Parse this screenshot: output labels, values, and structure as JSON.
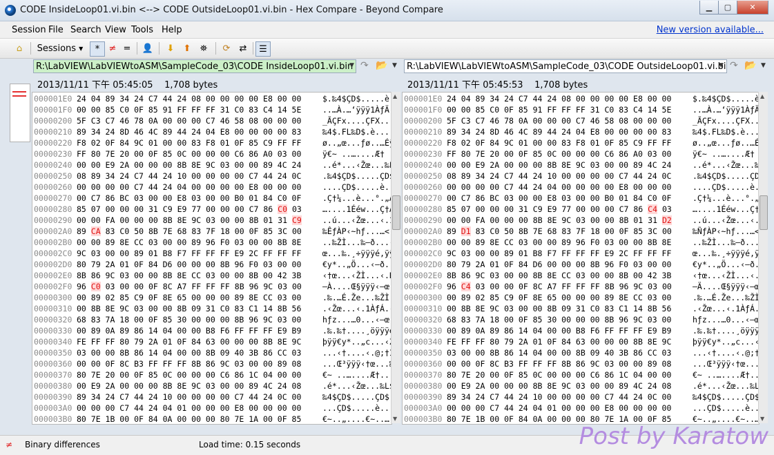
{
  "window": {
    "title": "CODE InsideLoop01.vi.bin <--> CODE OutsideLoop01.vi.bin - Hex Compare - Beyond Compare"
  },
  "menu": {
    "items": [
      "Session",
      "File",
      "Search",
      "View",
      "Tools",
      "Help"
    ],
    "new_version": "New version available..."
  },
  "toolbar": {
    "sessions_label": "Sessions"
  },
  "left": {
    "path": "R:\\LabVIEW\\LabVIEWtoASM\\SampleCode_03\\CODE InsideLoop01.vi.bin",
    "timestamp": "2013/11/11 下午 05:45:05",
    "size": "1,708 bytes"
  },
  "right": {
    "path": "R:\\LabVIEW\\LabVIEWtoASM\\SampleCode_03\\CODE OutsideLoop01.vi.bin",
    "timestamp": "2013/11/11 下午 05:45:53",
    "size": "1,708 bytes"
  },
  "rows": [
    {
      "off": "000001E0",
      "hex": "24 04 89 34 24 C7 44 24 08 00 00 00 00 E8 00 00",
      "asc": "$.‰4$ÇD$.....è.."
    },
    {
      "off": "000001F0",
      "hex": "00 00 85 C0 0F 85 91 FF FF FF 31 C0 83 C4 14 5E",
      "asc": "..…À.…‘ÿÿÿ1ÀƒÄ.^"
    },
    {
      "off": "00000200",
      "hex": "5F C3 C7 46 78 0A 00 00 00 C7 46 58 08 00 00 00",
      "asc": "_ÃÇFx....ÇFX...."
    },
    {
      "off": "00000210",
      "hex": "89 34 24 8D 46 4C 89 44 24 04 E8 00 00 00 00 83",
      "asc": "‰4$.FL‰D$.è....ƒ"
    },
    {
      "off": "00000220",
      "hex": "F8 02 0F 84 9C 01 00 00 83 F8 01 0F 85 C9 FF FF",
      "asc": "ø..„œ...ƒø..…Éÿÿ"
    },
    {
      "off": "00000230",
      "hex": "FF 80 7E 20 00 0F 85 0C 00 00 00 C6 86 A0 03 00",
      "asc": "ÿ€~ ..…....Æ† .."
    },
    {
      "off": "00000240",
      "hex": "00 00 E9 2A 00 00 00 8B 8E 9C 03 00 00 89 4C 24",
      "asc": "..é*...‹Žœ...‰L$"
    },
    {
      "off": "00000250",
      "hex": "08 89 34 24 C7 44 24 10 00 00 00 00 C7 44 24 0C",
      "asc": ".‰4$ÇD$.....ÇD$."
    },
    {
      "off": "00000260",
      "hex": "00 00 00 00 C7 44 24 04 00 00 00 00 E8 00 00 00",
      "asc": "....ÇD$.....è..."
    },
    {
      "off": "00000270",
      "hex": "00 C7 86 BC 03 00 00 E8 03 00 00 B0 01 84 C0 0F",
      "asc": ".Ç†¼...è...°.„À."
    },
    {
      "off": "00000280",
      "hex": "85 07 00 00 00 31 C9 E9 77 00 00 00 C7 86 C0 03",
      "asc": "…....1Ééw...Ç†À."
    },
    {
      "off": "00000290",
      "hex": "00 00 FA 00 00 00 8B 8E 9C 03 00 00 8B 01 31 C9",
      "asc": "..ú...‹Žœ...‹.1É"
    },
    {
      "off": "000002A0",
      "hex": "89 CA 83 C0 50 8B 7E 68 83 7F 18 00 0F 85 3C 00",
      "asc": "‰ÊƒÀP‹~hƒ...…<."
    },
    {
      "off": "000002B0",
      "hex": "00 00 89 8E CC 03 00 00 89 96 F0 03 00 00 8B 8E",
      "asc": "..‰ŽÌ...‰–ð...‹Ž"
    },
    {
      "off": "000002C0",
      "hex": "9C 03 00 00 89 01 B8 F7 FF FF FF E9 2C FF FF FF",
      "asc": "œ...‰.¸÷ÿÿÿé,ÿÿÿ"
    },
    {
      "off": "000002D0",
      "hex": "80 79 2A 01 0F 84 D6 00 00 00 8B 96 F0 03 00 00",
      "asc": "€y*..„Ö...‹–ð..."
    },
    {
      "off": "000002E0",
      "hex": "8B 86 9C 03 00 00 8B 8E CC 03 00 00 8B 00 42 3B",
      "asc": "‹†œ...‹ŽÌ...‹.B;"
    },
    {
      "off": "000002F0",
      "hex": "96 C0 03 00 00 0F 8C A7 FF FF FF 8B 96 9C 03 00",
      "asc": "–À....Œ§ÿÿÿ‹–œ.."
    },
    {
      "off": "00000300",
      "hex": "00 89 02 85 C9 0F 8E 65 00 00 00 89 8E CC 03 00",
      "asc": ".‰.…É.Že...‰ŽÌ.."
    },
    {
      "off": "00000310",
      "hex": "00 8B 8E 9C 03 00 00 8B 09 31 C0 83 C1 14 8B 56",
      "asc": ".‹Žœ...‹.1ÀƒÁ.‹V"
    },
    {
      "off": "00000320",
      "hex": "68 83 7A 18 00 0F 85 30 00 00 00 8B 96 9C 03 00",
      "asc": "hƒz...…0...‹–œ.."
    },
    {
      "off": "00000330",
      "hex": "00 89 0A 89 86 14 04 00 00 B8 F6 FF FF FF E9 B9",
      "asc": ".‰.‰†....¸öÿÿÿé¹"
    },
    {
      "off": "00000340",
      "hex": "FE FF FF 80 79 2A 01 0F 84 63 00 00 00 8B 8E 9C",
      "asc": "þÿÿ€y*..„c...‹Žœ"
    },
    {
      "off": "00000350",
      "hex": "03 00 00 8B 86 14 04 00 00 8B 09 40 3B 86 CC 03",
      "asc": "...‹†....‹.@;†Ì."
    },
    {
      "off": "00000360",
      "hex": "00 00 0F 8C B3 FF FF FF 8B 86 9C 03 00 00 89 08",
      "asc": "...Œ³ÿÿÿ‹†œ...‰."
    },
    {
      "off": "00000370",
      "hex": "80 7E 20 00 0F 85 0C 00 00 00 C6 86 1C 04 00 00",
      "asc": "€~ ..…....Æ†...."
    },
    {
      "off": "00000380",
      "hex": "00 E9 2A 00 00 00 8B 8E 9C 03 00 00 89 4C 24 08",
      "asc": ".é*...‹Žœ...‰L$."
    },
    {
      "off": "00000390",
      "hex": "89 34 24 C7 44 24 10 00 00 00 00 C7 44 24 0C 00",
      "asc": "‰4$ÇD$.....ÇD$.."
    },
    {
      "off": "000003A0",
      "hex": "00 00 00 C7 44 24 04 01 00 00 00 E8 00 00 00 00",
      "asc": "...ÇD$.....è...."
    },
    {
      "off": "000003B0",
      "hex": "80 7E 1B 00 0F 84 0A 00 00 00 80 7E 1A 00 0F 85",
      "asc": "€~..„....€~..…"
    }
  ],
  "left_diffs": {
    "10": [
      "C0"
    ],
    "11": [
      "C9"
    ],
    "12": [
      "CA"
    ],
    "17": [
      "C0"
    ]
  },
  "right_diffs": {
    "10": [
      "C4"
    ],
    "11": [
      "D2"
    ],
    "12": [
      "D1"
    ],
    "17": [
      "C4"
    ]
  },
  "right_diff_values": {
    "00000280": "C4",
    "00000290": "D2",
    "000002A0": "D1",
    "000002F0": "C4"
  },
  "right_diff_ascii": {
    "00000280": "…....1Ééw...Ç†Ä.",
    "00000290": "..ú...‹Žœ...‹.1Ò",
    "000002A0": "‰ÑƒÀP‹~hƒ...…<.",
    "000002F0": "–Ä....Œ§ÿÿÿ‹–œ.."
  },
  "status": {
    "diff_label": "Binary differences",
    "load_time": "Load time: 0.15 seconds"
  },
  "watermark": "Post by Karatow"
}
